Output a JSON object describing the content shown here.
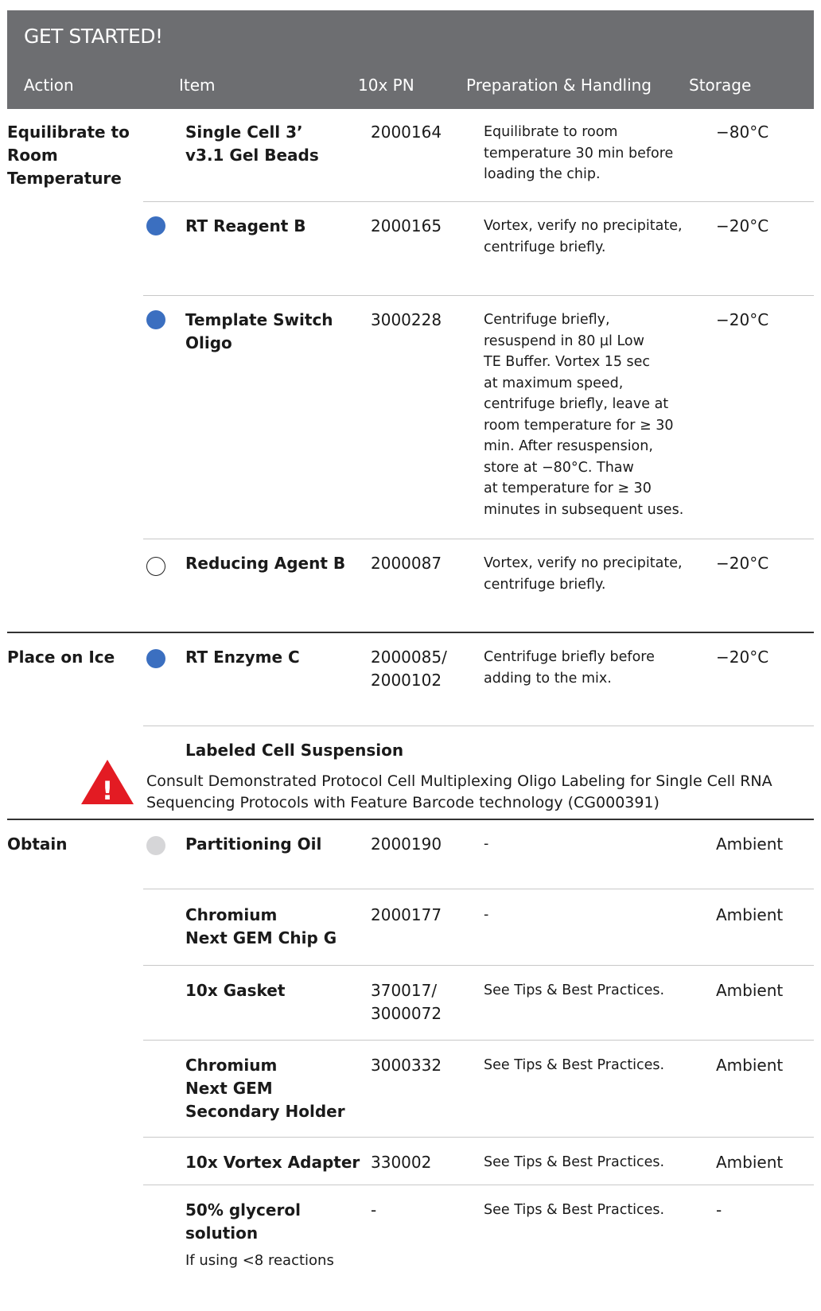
{
  "header": {
    "title": "GET STARTED!",
    "columns": {
      "action": "Action",
      "item": "Item",
      "pn": "10x PN",
      "prep": "Preparation & Handling",
      "storage": "Storage"
    }
  },
  "colors": {
    "header_bg": "#6d6e71",
    "dot_blue": "#3b6fc0",
    "dot_gray": "#d6d6d8",
    "warning_red": "#e31b23"
  },
  "groups": {
    "equilibrate": "Equilibrate to\nRoom\nTemperature",
    "ice": "Place on Ice",
    "obtain": "Obtain"
  },
  "rows": [
    {
      "item": "Single Cell 3’\nv3.1 Gel Beads",
      "pn": "2000164",
      "prep": "Equilibrate to room\ntemperature 30 min before\nloading the chip.",
      "storage": "−80°C"
    },
    {
      "item": "RT Reagent B",
      "pn": "2000165",
      "prep": "Vortex, verify no precipitate,\ncentrifuge briefly.",
      "storage": "−20°C",
      "dot": "blue"
    },
    {
      "item": "Template Switch\nOligo",
      "pn": "3000228",
      "prep": "Centrifuge briefly,\nresuspend in 80 µl Low\nTE Buffer. Vortex 15 sec\nat maximum speed,\ncentrifuge briefly, leave at\nroom temperature for ≥ 30\nmin. After resuspension,\nstore at −80°C. Thaw\nat temperature for ≥ 30\nminutes in subsequent uses.",
      "storage": "−20°C",
      "dot": "blue"
    },
    {
      "item": "Reducing Agent B",
      "pn": "2000087",
      "prep": "Vortex, verify no precipitate,\ncentrifuge briefly.",
      "storage": "−20°C",
      "dot": "white"
    },
    {
      "item": "RT Enzyme C",
      "pn": "2000085/\n2000102",
      "prep": "Centrifuge briefly before\nadding to the mix.",
      "storage": "−20°C",
      "dot": "blue"
    },
    {
      "item": "Partitioning Oil",
      "pn": "2000190",
      "prep": "-",
      "storage": "Ambient",
      "dot": "gray"
    },
    {
      "item": "Chromium\nNext GEM Chip G",
      "pn": "2000177",
      "prep": "-",
      "storage": "Ambient"
    },
    {
      "item": "10x Gasket",
      "pn": "370017/\n3000072",
      "prep": "See Tips & Best Practices.",
      "storage": "Ambient"
    },
    {
      "item": "Chromium\nNext GEM\nSecondary Holder",
      "pn": "3000332",
      "prep": "See Tips & Best Practices.",
      "storage": "Ambient"
    },
    {
      "item": "10x Vortex Adapter",
      "pn": "330002",
      "prep": "See Tips & Best Practices.",
      "storage": "Ambient"
    },
    {
      "item": "50% glycerol\nsolution",
      "item_note": "If using <8 reactions",
      "pn": "-",
      "prep": "See Tips & Best Practices.",
      "storage": "-"
    }
  ],
  "note": {
    "title": "Labeled Cell Suspension",
    "text": "Consult Demonstrated Protocol Cell Multiplexing Oligo Labeling for Single Cell RNA Sequencing Protocols with Feature Barcode technology (CG000391)",
    "icon": "warning-icon"
  }
}
